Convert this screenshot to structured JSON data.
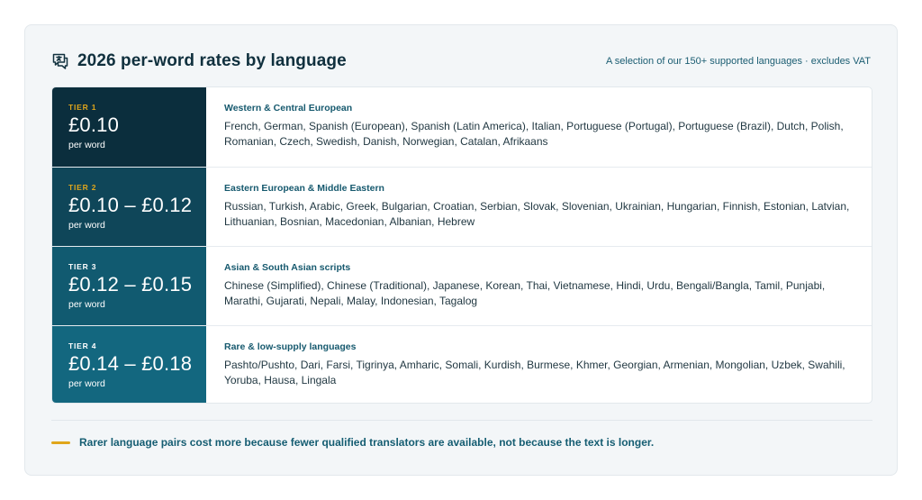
{
  "header": {
    "icon": "translate-chat-icon",
    "title": "2026 per-word rates by language",
    "subtitle": "A selection of our 150+ supported languages · excludes VAT"
  },
  "tiers": [
    {
      "label": "TIER 1",
      "price": "£0.10",
      "unit": "per word",
      "group": "Western & Central European",
      "languages": "French, German, Spanish (European), Spanish (Latin America), Italian, Portuguese (Portugal), Portuguese (Brazil), Dutch, Polish, Romanian, Czech, Swedish, Danish, Norwegian, Catalan, Afrikaans",
      "bg": "#0b2e3d",
      "label_color": "#e0a61b"
    },
    {
      "label": "TIER 2",
      "price": "£0.10 – £0.12",
      "unit": "per word",
      "group": "Eastern European & Middle Eastern",
      "languages": "Russian, Turkish, Arabic, Greek, Bulgarian, Croatian, Serbian, Slovak, Slovenian, Ukrainian, Hungarian, Finnish, Estonian, Latvian, Lithuanian, Bosnian, Macedonian, Albanian, Hebrew",
      "bg": "#0f4659",
      "label_color": "#e0a61b"
    },
    {
      "label": "TIER 3",
      "price": "£0.12 – £0.15",
      "unit": "per word",
      "group": "Asian & South Asian scripts",
      "languages": "Chinese (Simplified), Chinese (Traditional), Japanese, Korean, Thai, Vietnamese, Hindi, Urdu, Bengali/Bangla, Tamil, Punjabi, Marathi, Gujarati, Nepali, Malay, Indonesian, Tagalog",
      "bg": "#115a70",
      "label_color": "#ffffff"
    },
    {
      "label": "TIER 4",
      "price": "£0.14 – £0.18",
      "unit": "per word",
      "group": "Rare & low-supply languages",
      "languages": "Pashto/Pushto, Dari, Farsi, Tigrinya, Amharic, Somali, Kurdish, Burmese, Khmer, Georgian, Armenian, Mongolian, Uzbek, Swahili, Yoruba, Hausa, Lingala",
      "bg": "#13677f",
      "label_color": "#ffffff"
    }
  ],
  "footer": {
    "note": "Rarer language pairs cost more because fewer qualified translators are available, not because the text is longer.",
    "accent": "#e0a61b"
  }
}
